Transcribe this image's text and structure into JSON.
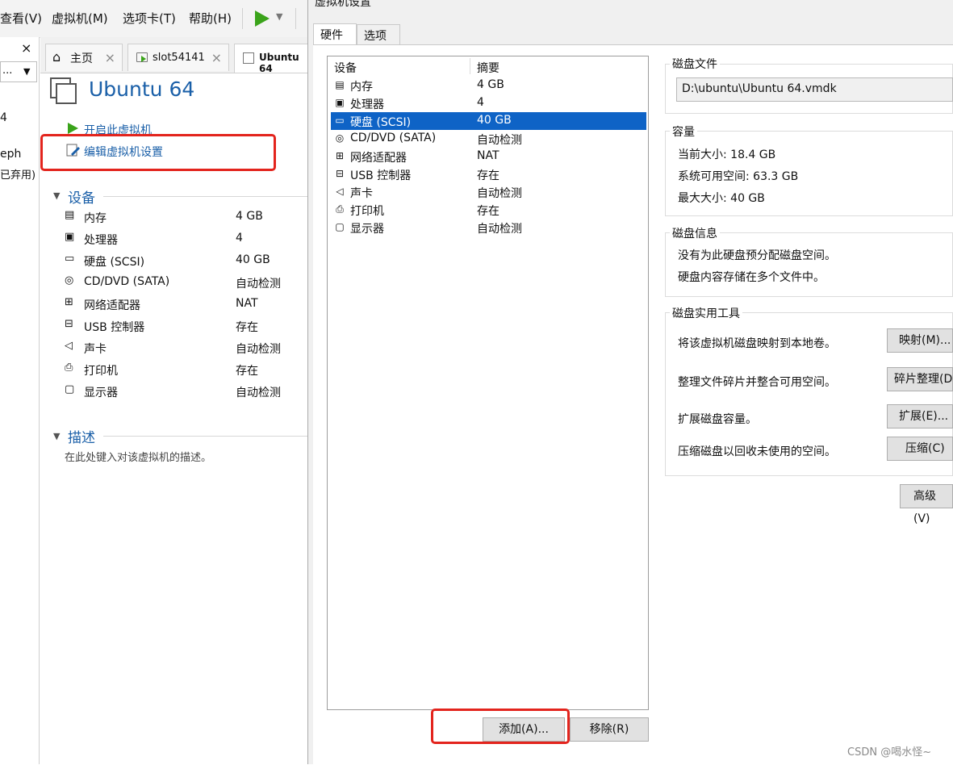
{
  "menu": {
    "items": [
      "查看(V)",
      "虚拟机(M)",
      "选项卡(T)",
      "帮助(H)"
    ]
  },
  "left_strip": {
    "close": "×",
    "dropdown": "...",
    "items": [
      "4",
      "eph",
      "已弃用)"
    ]
  },
  "tabs": [
    {
      "label": "主页",
      "close": "×"
    },
    {
      "label": "slot54141",
      "close": "×"
    },
    {
      "label": "Ubuntu 64"
    }
  ],
  "vm": {
    "title": "Ubuntu 64",
    "actions": {
      "power_on": "开启此虚拟机",
      "edit_settings": "编辑虚拟机设置"
    },
    "devices_header": "设备",
    "devices": [
      {
        "name": "内存",
        "value": "4 GB",
        "icon": "memory-icon"
      },
      {
        "name": "处理器",
        "value": "4",
        "icon": "cpu-icon"
      },
      {
        "name": "硬盘 (SCSI)",
        "value": "40 GB",
        "icon": "harddisk-icon"
      },
      {
        "name": "CD/DVD (SATA)",
        "value": "自动检测",
        "icon": "cd-icon"
      },
      {
        "name": "网络适配器",
        "value": "NAT",
        "icon": "network-icon"
      },
      {
        "name": "USB 控制器",
        "value": "存在",
        "icon": "usb-icon"
      },
      {
        "name": "声卡",
        "value": "自动检测",
        "icon": "sound-icon"
      },
      {
        "name": "打印机",
        "value": "存在",
        "icon": "printer-icon"
      },
      {
        "name": "显示器",
        "value": "自动检测",
        "icon": "monitor-icon"
      }
    ],
    "description_header": "描述",
    "description_placeholder": "在此处键入对该虚拟机的描述。"
  },
  "dialog": {
    "title": "虚拟机设置",
    "tabs": [
      "硬件",
      "选项"
    ],
    "list_headers": {
      "device": "设备",
      "summary": "摘要"
    },
    "buttons": {
      "add": "添加(A)...",
      "remove": "移除(R)"
    },
    "disk_file": {
      "title": "磁盘文件",
      "path": "D:\\ubuntu\\Ubuntu 64.vmdk"
    },
    "capacity": {
      "title": "容量",
      "current": "当前大小: 18.4 GB",
      "available": "系统可用空间: 63.3 GB",
      "max": "最大大小: 40 GB"
    },
    "disk_info": {
      "title": "磁盘信息",
      "line1": "没有为此硬盘预分配磁盘空间。",
      "line2": "硬盘内容存储在多个文件中。"
    },
    "utilities": {
      "title": "磁盘实用工具",
      "rows": [
        {
          "text": "将该虚拟机磁盘映射到本地卷。",
          "button": "映射(M)..."
        },
        {
          "text": "整理文件碎片并整合可用空间。",
          "button": "碎片整理(D"
        },
        {
          "text": "扩展磁盘容量。",
          "button": "扩展(E)..."
        },
        {
          "text": "压缩磁盘以回收未使用的空间。",
          "button": "压缩(C)"
        }
      ]
    },
    "advanced": "高级(V)"
  },
  "watermark": "CSDN @喝水怪~",
  "colors": {
    "accent": "#1a5fa8",
    "selection": "#0e63c6",
    "highlight_box": "#e3241d",
    "play": "#3aa31a"
  }
}
